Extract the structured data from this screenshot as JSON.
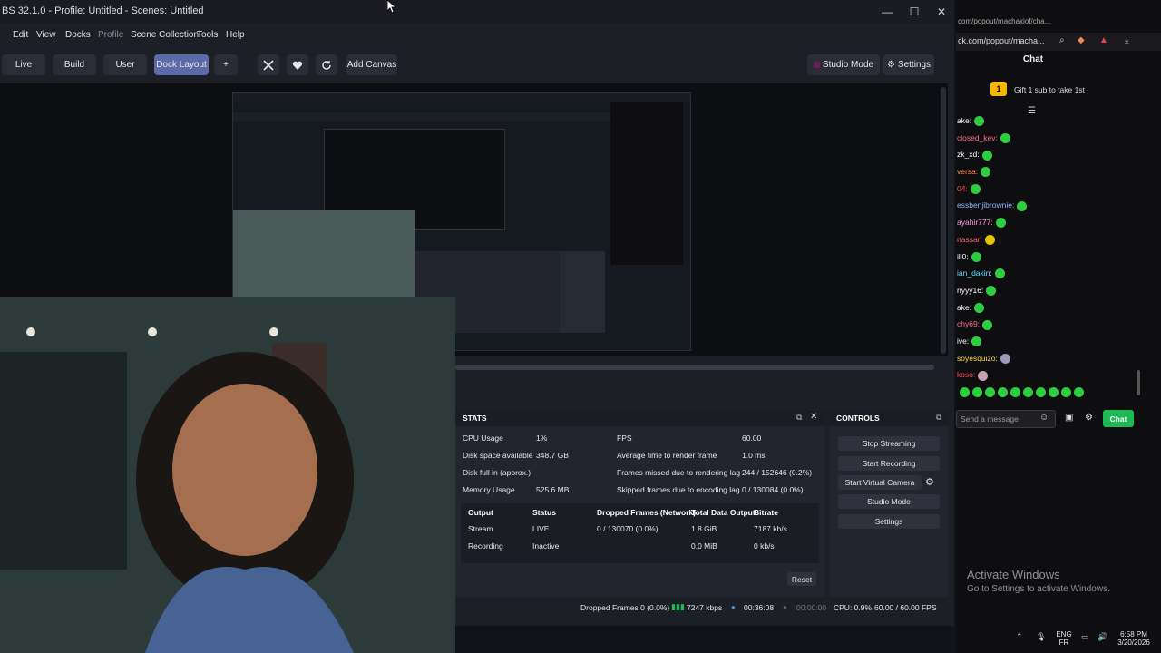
{
  "window": {
    "title": "BS 32.1.0 - Profile: Untitled - Scenes: Untitled",
    "minimize": "—",
    "maximize": "☐",
    "close": "✕"
  },
  "menu": [
    "Edit",
    "View",
    "Docks",
    "Profile",
    "Scene Collection",
    "Tools",
    "Help"
  ],
  "toolbar": {
    "live": "Live",
    "build": "Build",
    "user": "User",
    "dock_layout": "Dock Layout",
    "plus": "+",
    "add_canvas": "Add Canvas",
    "studio_mode": "Studio Mode",
    "settings": "Settings"
  },
  "stats": {
    "title": "STATS",
    "left": [
      {
        "label": "CPU Usage",
        "value": "1%"
      },
      {
        "label": "Disk space available",
        "value": "348.7 GB"
      },
      {
        "label": "Disk full in (approx.)",
        "value": ""
      },
      {
        "label": "Memory Usage",
        "value": "525.6 MB"
      }
    ],
    "right": [
      {
        "label": "FPS",
        "value": "60.00"
      },
      {
        "label": "Average time to render frame",
        "value": "1.0 ms"
      },
      {
        "label": "Frames missed due to rendering lag",
        "value": "244 / 152646 (0.2%)"
      },
      {
        "label": "Skipped frames due to encoding lag",
        "value": "0 / 130084 (0.0%)"
      }
    ],
    "table_headers": [
      "Output",
      "Status",
      "Dropped Frames (Network)",
      "Total Data Output",
      "Bitrate"
    ],
    "rows": [
      [
        "Stream",
        "LIVE",
        "0 / 130070 (0.0%)",
        "1.8 GiB",
        "7187 kb/s"
      ],
      [
        "Recording",
        "Inactive",
        "",
        "0.0 MiB",
        "0 kb/s"
      ]
    ],
    "reset": "Reset"
  },
  "controls": {
    "title": "CONTROLS",
    "stop_streaming": "Stop Streaming",
    "start_recording": "Start Recording",
    "start_virtual_camera": "Start Virtual Camera",
    "studio_mode": "Studio Mode",
    "settings": "Settings"
  },
  "statusbar": {
    "dropped": "Dropped Frames 0 (0.0%)",
    "kbps": "7247 kbps",
    "stream_time": "00:36:08",
    "rec_time": "00:00:00",
    "cpu": "CPU: 0.9%",
    "fps": "60.00 / 60.00 FPS"
  },
  "chat": {
    "url": "ck.com/popout/macha...",
    "tab_url": "com/popout/machakiof/cha...",
    "title": "Chat",
    "gift": "Gift 1 sub to take 1st",
    "users": [
      "ake:",
      "closed_kev:",
      "zk_xd:",
      "versa:",
      "04:",
      "essbenjibrownie:",
      "ayahir777:",
      "nassar:",
      "ill0:",
      "ian_dakin:",
      "nyyy16:",
      "ake:",
      "chy69:",
      "ive:",
      "soyesquizo:",
      "koso:"
    ],
    "input_placeholder": "Send a message",
    "chat_button": "Chat"
  },
  "overlay": {
    "activate_title": "Activate Windows",
    "activate_sub": "Go to Settings to activate Windows."
  },
  "tray": {
    "lang1": "ENG",
    "lang2": "FR",
    "time": "6:58 PM",
    "date": "3/20/2026"
  },
  "colors": {
    "accent": "#5b6aa8",
    "live_green": "#1db954",
    "chat_green": "#2ecc40"
  }
}
